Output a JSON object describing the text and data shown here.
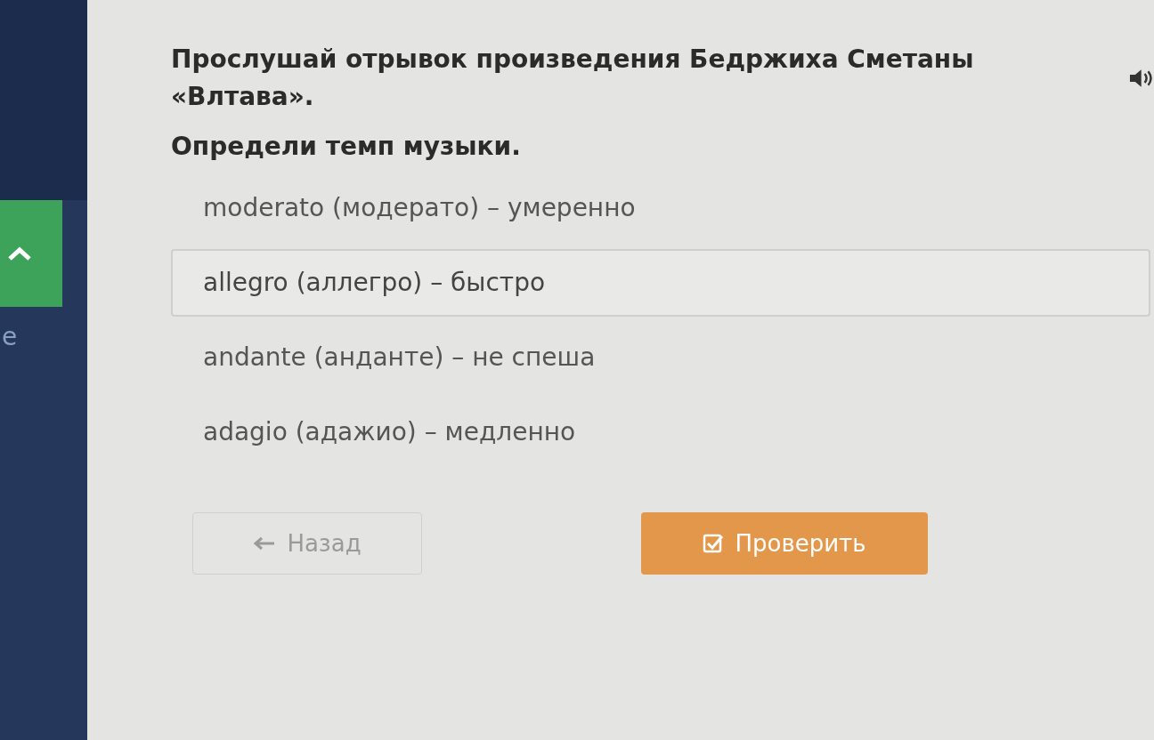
{
  "sidebar": {
    "cut_label": "e"
  },
  "task": {
    "title": "Прослушай отрывок произведения Бедржиха Сметаны «Влтава».",
    "question": "Определи темп музыки."
  },
  "options": [
    {
      "text": "moderato (модерато) – умеренно",
      "selected": false
    },
    {
      "text": "allegro (аллегро) – быстро",
      "selected": true
    },
    {
      "text": "andante (анданте) – не спеша",
      "selected": false
    },
    {
      "text": "adagio (адажио) – медленно",
      "selected": false
    }
  ],
  "buttons": [
    {
      "kind": "back",
      "label": "Назад",
      "disabled": true
    },
    {
      "kind": "check",
      "label": "Проверить",
      "disabled": false
    }
  ]
}
